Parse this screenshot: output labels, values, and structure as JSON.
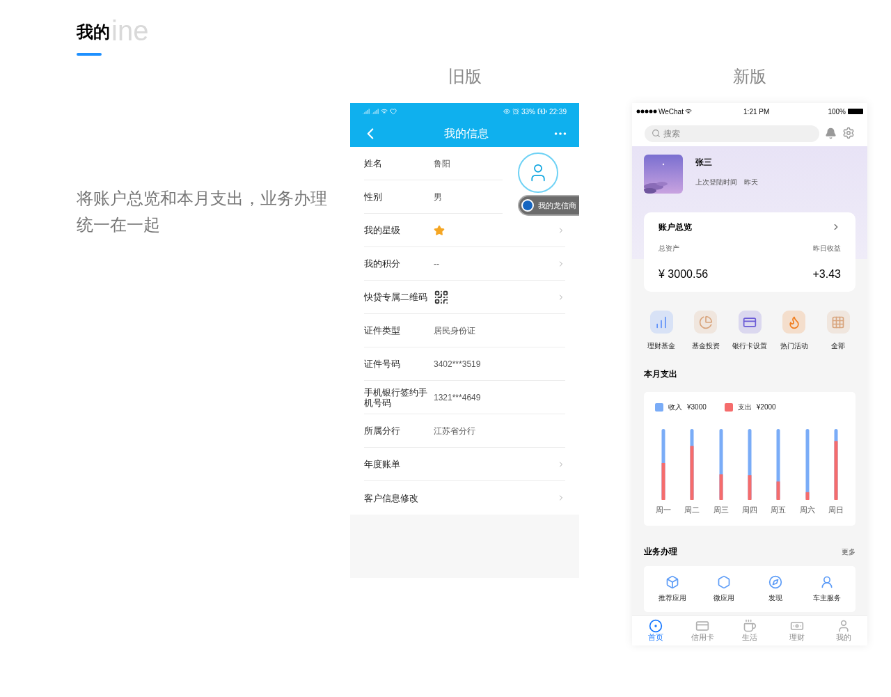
{
  "page": {
    "title": "我的",
    "title_bg": "ine",
    "description": "将账户总览和本月支出，业务办理统一在一起"
  },
  "old": {
    "label": "旧版",
    "status": {
      "battery": "33%",
      "time": "22:39"
    },
    "title": "我的信息",
    "avatar_badge": "我的龙信商",
    "rows": [
      {
        "kind": "text",
        "label": "姓名",
        "value": "鲁阳",
        "arrow": false
      },
      {
        "kind": "text",
        "label": "性别",
        "value": "男",
        "arrow": false
      },
      {
        "kind": "stars",
        "label": "我的星级",
        "stars": 1,
        "arrow": true
      },
      {
        "kind": "text",
        "label": "我的积分",
        "value": "--",
        "arrow": true
      },
      {
        "kind": "qr",
        "label": "快贷专属二维码",
        "arrow": true
      },
      {
        "kind": "text",
        "label": "证件类型",
        "value": "居民身份证",
        "arrow": false
      },
      {
        "kind": "text",
        "label": "证件号码",
        "value": "3402***3519",
        "arrow": false
      },
      {
        "kind": "text",
        "label": "手机银行签约手机号码",
        "value": "1321***4649",
        "arrow": false
      },
      {
        "kind": "text",
        "label": "所属分行",
        "value": "江苏省分行",
        "arrow": false
      },
      {
        "kind": "text",
        "label": "年度账单",
        "arrow": true
      },
      {
        "kind": "text",
        "label": "客户信息修改",
        "arrow": true
      }
    ]
  },
  "new": {
    "label": "新版",
    "status": {
      "carrier": "WeChat",
      "time": "1:21 PM",
      "battery": "100%"
    },
    "search": {
      "placeholder": "搜索"
    },
    "user": {
      "name": "张三",
      "last_login_label": "上次登陆时间",
      "last_login": "昨天"
    },
    "account": {
      "title": "账户总览",
      "total_label": "总资产",
      "yesterday_label": "昨日收益",
      "total": "¥ 3000.56",
      "yesterday": "+3.43"
    },
    "shortcuts": [
      {
        "label": "理财基金",
        "color": "#5b8ff9"
      },
      {
        "label": "基金投资",
        "color": "#d8a47c"
      },
      {
        "label": "银行卡设置",
        "color": "#6a5ad6"
      },
      {
        "label": "热门活动",
        "color": "#f07c1c"
      },
      {
        "label": "全部",
        "color": "#d8a47c"
      }
    ],
    "spending": {
      "title": "本月支出",
      "legend": [
        {
          "label": "收入",
          "amount": "¥3000",
          "color": "#7aacf7"
        },
        {
          "label": "支出",
          "amount": "¥2000",
          "color": "#f56c6c"
        }
      ],
      "days": [
        "周一",
        "周二",
        "周三",
        "周四",
        "周五",
        "周六",
        "周日"
      ]
    },
    "business": {
      "title": "业务办理",
      "more": "更多",
      "items": [
        {
          "label": "推荐应用"
        },
        {
          "label": "微应用"
        },
        {
          "label": "发现"
        },
        {
          "label": "车主服务"
        }
      ]
    },
    "tabs": [
      {
        "label": "首页",
        "selected": true
      },
      {
        "label": "信用卡",
        "selected": false
      },
      {
        "label": "生活",
        "selected": false
      },
      {
        "label": "理财",
        "selected": false
      },
      {
        "label": "我的",
        "selected": false
      }
    ]
  }
}
